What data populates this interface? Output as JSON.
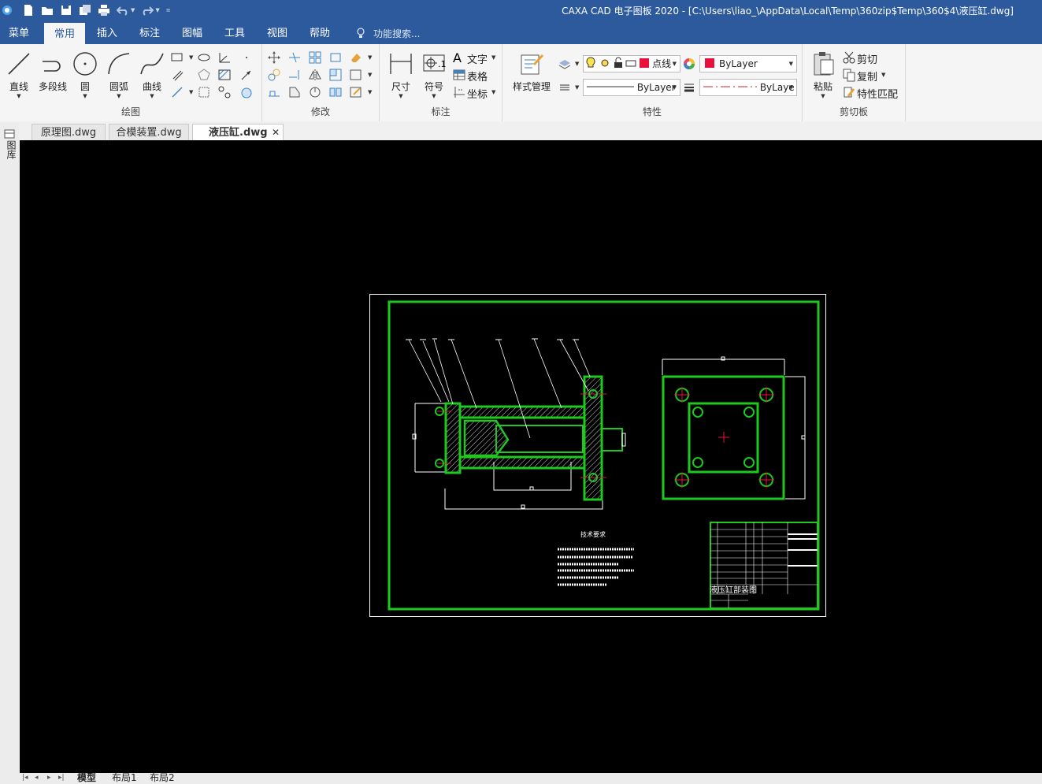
{
  "window": {
    "title": "CAXA CAD 电子图板 2020 - [C:\\Users\\liao_\\AppData\\Local\\Temp\\360zip$Temp\\360$4\\液压缸.dwg]"
  },
  "menu": {
    "tabs": [
      "菜单",
      "常用",
      "插入",
      "标注",
      "图幅",
      "工具",
      "视图",
      "帮助"
    ],
    "active": "常用",
    "search_placeholder": "功能搜索..."
  },
  "ribbon": {
    "draw": {
      "label": "绘图",
      "line": "直线",
      "polyline": "多段线",
      "circle": "圆",
      "arc": "圆弧",
      "curve": "曲线"
    },
    "modify": {
      "label": "修改"
    },
    "annotate": {
      "label": "标注",
      "dimension": "尺寸",
      "symbol": "符号",
      "text": "文字",
      "table": "表格",
      "coordinate": "坐标"
    },
    "properties": {
      "label": "特性",
      "style_manager": "样式管理",
      "layer": "点线",
      "color": "ByLayer",
      "linetype": "ByLayer",
      "lineweight": "ByLaye",
      "layer_color": "#e8123c"
    },
    "clipboard": {
      "label": "剪切板",
      "paste": "粘贴",
      "cut": "剪切",
      "copy": "复制",
      "match": "特性匹配"
    }
  },
  "docs": {
    "tabs": [
      "原理图.dwg",
      "合模装置.dwg",
      "液压缸.dwg"
    ],
    "active": "液压缸.dwg",
    "side_label": "图库"
  },
  "drawing": {
    "tech_title": "技术要求",
    "part_name": "液压缸部装图",
    "frame_color": "#1ec81e"
  },
  "layouts": [
    "模型",
    "布局1",
    "布局2"
  ],
  "active_layout": "模型"
}
